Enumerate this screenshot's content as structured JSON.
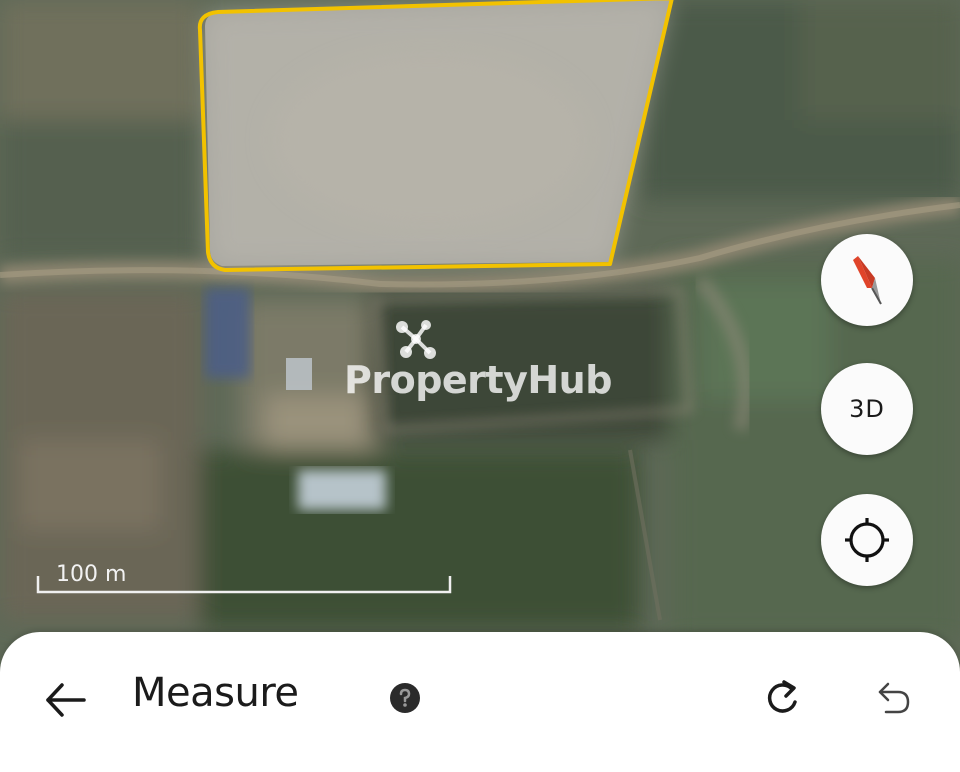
{
  "app": {
    "watermark": "PropertyHub"
  },
  "map": {
    "scale_label": "100 m",
    "boundary_color": "#f2c200"
  },
  "controls": {
    "three_d_label": "3D",
    "compass_icon": "compass-icon",
    "locate_icon": "crosshair-icon"
  },
  "bottom_sheet": {
    "title": "Measure",
    "back_icon": "arrow-left-icon",
    "help_icon": "help-icon",
    "redo_icon": "redo-icon",
    "undo_icon": "undo-icon"
  }
}
